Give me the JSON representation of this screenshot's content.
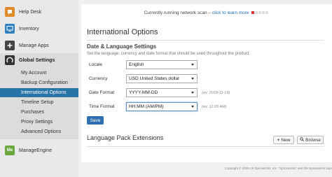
{
  "sidebar": {
    "top_items": [
      {
        "label": "Help Desk",
        "icon": "help-desk-icon",
        "color": "#e08a2a"
      },
      {
        "label": "Inventory",
        "icon": "monitor-icon",
        "color": "#2f7fc1"
      },
      {
        "label": "Manage Apps",
        "icon": "plus-icon",
        "color": "#444444"
      }
    ],
    "section": {
      "label": "Global Settings",
      "items": [
        {
          "label": "My Account"
        },
        {
          "label": "Backup Configuration"
        },
        {
          "label": "International Options"
        },
        {
          "label": "Timeline Setup"
        },
        {
          "label": "Purchases"
        },
        {
          "label": "Proxy Settings"
        },
        {
          "label": "Advanced Options"
        }
      ]
    },
    "bottom_item": {
      "label": "ManageEngine",
      "icon": "manageengine-icon",
      "color": "#6aa83e"
    }
  },
  "status": {
    "text": "Currently running network scan –",
    "link": "click to learn more"
  },
  "main": {
    "title": "International Options",
    "section_title": "Date & Language Settings",
    "section_subtitle": "Set the language, currency and date format that should be used throughout the product.",
    "fields": [
      {
        "label": "Locale",
        "value": "English",
        "hint": ""
      },
      {
        "label": "Currency",
        "value": "USD United States dollar",
        "hint": ""
      },
      {
        "label": "Date Format",
        "value": "YYYY-MM-DD",
        "hint": "(ex: 2018-11-19)"
      },
      {
        "label": "Time Format",
        "value": "HH:MM (AM/PM)",
        "hint": "(ex: 11:05 AM)"
      }
    ],
    "save_label": "Save",
    "lp_title": "Language Pack Extensions",
    "new_label": "New",
    "browse_label": "Browse"
  },
  "footer": {
    "text": "Copyright © 2006-19 Spiceworks, Inc. \"Spiceworks\" and the Spiceworks logo"
  }
}
